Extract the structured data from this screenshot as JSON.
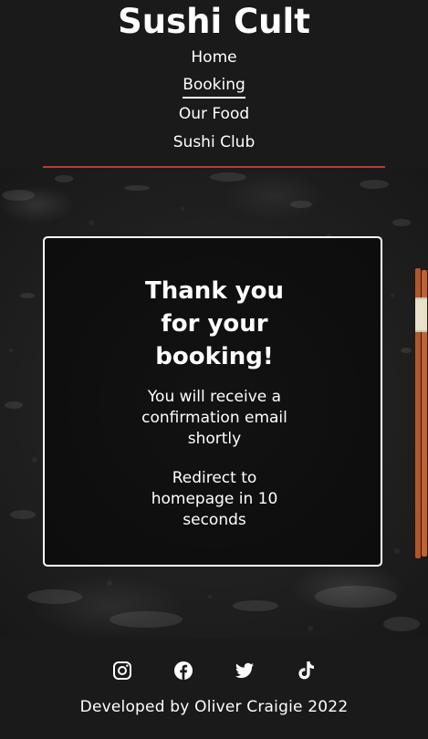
{
  "header": {
    "site_title": "Sushi Cult",
    "nav": [
      {
        "label": "Home",
        "active": false
      },
      {
        "label": "Booking",
        "active": true
      },
      {
        "label": "Our Food",
        "active": false
      },
      {
        "label": "Sushi Club",
        "active": false
      }
    ],
    "rule_color": "#c0392b"
  },
  "confirmation": {
    "heading": "Thank you for your booking!",
    "message": "You will receive a confirmation email shortly",
    "redirect": "Redirect to homepage in 10 seconds"
  },
  "footer": {
    "social": [
      {
        "name": "instagram-icon"
      },
      {
        "name": "facebook-icon"
      },
      {
        "name": "twitter-icon"
      },
      {
        "name": "tiktok-icon"
      }
    ],
    "credit": "Developed by Oliver Craigie 2022"
  },
  "colors": {
    "background": "#1a1a1a",
    "text": "#ffffff",
    "accent": "#c0392b"
  }
}
